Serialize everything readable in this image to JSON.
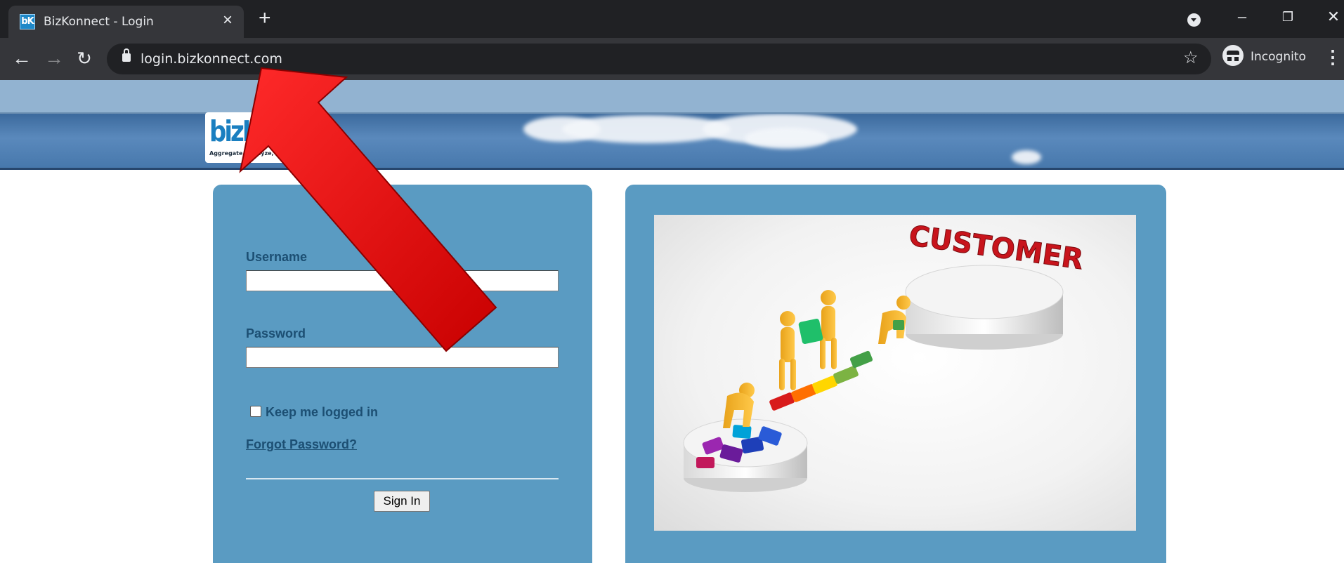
{
  "browser": {
    "tab_title": "BizKonnect - Login",
    "favicon_text": "bK",
    "url": "login.bizkonnect.com",
    "incognito_label": "Incognito"
  },
  "logo": {
    "word": "bizKonnect",
    "tagline": "Aggregate, Analyze,"
  },
  "login": {
    "username_label": "Username",
    "username_value": "",
    "password_label": "Password",
    "password_value": "",
    "keep_logged_in_label": "Keep me logged in",
    "keep_logged_in_checked": false,
    "forgot_password_label": "Forgot Password?",
    "signin_label": "Sign In"
  },
  "illustration": {
    "caption": "CUSTOMER"
  },
  "colors": {
    "panel": "#5a9bc2",
    "label": "#1c4f73",
    "arrow": "#e60000"
  }
}
